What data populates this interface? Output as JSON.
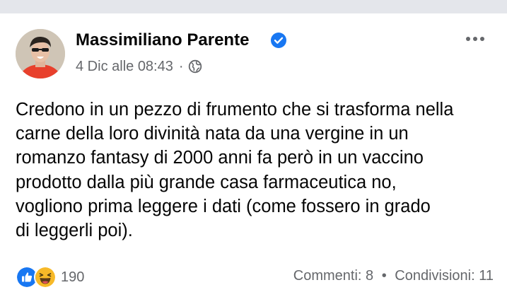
{
  "post": {
    "author": "Massimiliano Parente",
    "timestamp": "4 Dic alle 08:43",
    "separator": "·",
    "audience_icon": "globe-icon",
    "text": "Credono in un pezzo di frumento che si trasforma nella\ncarne della loro divinità nata da una vergine in un\nromanzo fantasy di 2000 anni fa però in un vaccino\nprodotto dalla più grande casa farmaceutica no,\nvogliono prima leggere i dati (come fossero in grado\ndi leggerli poi).",
    "reactions": {
      "icons": [
        "like-icon",
        "haha-icon"
      ],
      "count": "190"
    },
    "comments": "Commenti: 8",
    "stats_separator": "•",
    "shares": "Condivisioni: 11"
  },
  "colors": {
    "verified_blue": "#1877f2",
    "secondary_text": "#65676b",
    "like_blue": "#1877f2",
    "haha_yellow": "#f7b928"
  }
}
